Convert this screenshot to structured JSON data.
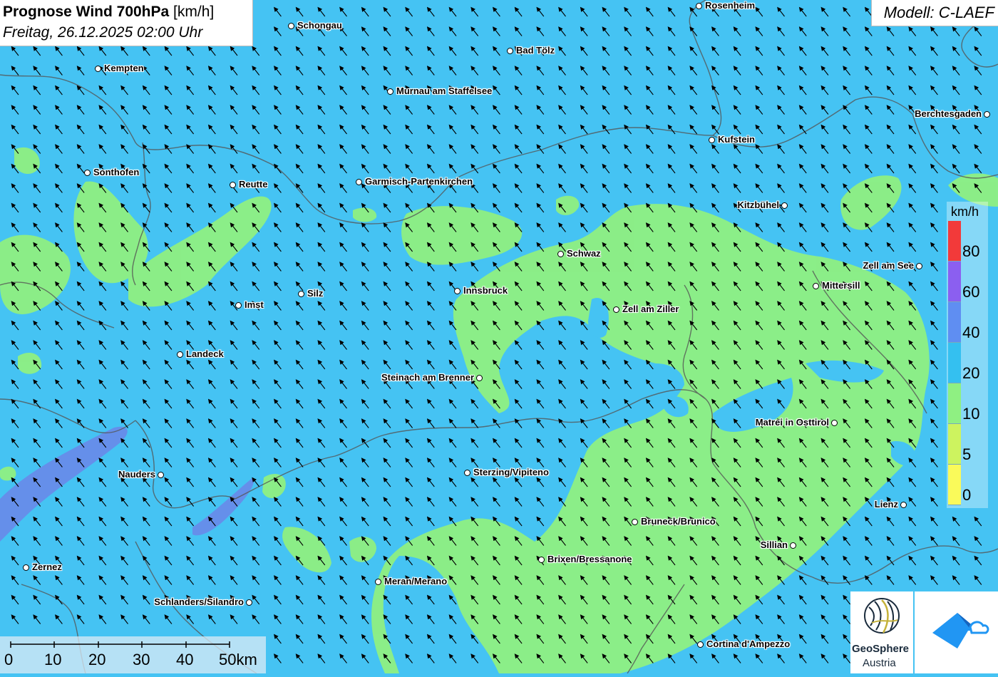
{
  "header": {
    "title_bold": "Prognose Wind 700hPa",
    "title_unit": "[km/h]",
    "subtitle": "Freitag, 26.12.2025 02:00 Uhr",
    "model": "Modell: C-LAEF"
  },
  "legend": {
    "unit": "km/h",
    "levels": [
      {
        "label": "80",
        "color": "#f23a3a"
      },
      {
        "label": "60",
        "color": "#8b5ff0"
      },
      {
        "label": "40",
        "color": "#5f8ef2"
      },
      {
        "label": "20",
        "color": "#34c0f0"
      },
      {
        "label": "10",
        "color": "#8ff082"
      },
      {
        "label": "5",
        "color": "#cdf35f"
      },
      {
        "label": "0",
        "color": "#fafa5a"
      }
    ]
  },
  "scalebar": {
    "labels": [
      "0",
      "10",
      "20",
      "30",
      "40",
      "50km"
    ]
  },
  "places": [
    {
      "name": "Rosenheim"
    },
    {
      "name": "Schongau"
    },
    {
      "name": "Bad Tölz"
    },
    {
      "name": "Kempten"
    },
    {
      "name": "Murnau am Staffelsee"
    },
    {
      "name": "Berchtesgaden"
    },
    {
      "name": "Kufstein"
    },
    {
      "name": "Sonthofen"
    },
    {
      "name": "Reutte"
    },
    {
      "name": "Garmisch-Partenkirchen"
    },
    {
      "name": "Kitzbühel"
    },
    {
      "name": "Schwaz"
    },
    {
      "name": "Zell am See"
    },
    {
      "name": "Mittersill"
    },
    {
      "name": "Innsbruck"
    },
    {
      "name": "Silz"
    },
    {
      "name": "Imst"
    },
    {
      "name": "Zell am Ziller"
    },
    {
      "name": "Landeck"
    },
    {
      "name": "Steinach am Brenner"
    },
    {
      "name": "Matrei in Osttirol"
    },
    {
      "name": "Nauders"
    },
    {
      "name": "Sterzing/Vipiteno"
    },
    {
      "name": "Lienz"
    },
    {
      "name": "Bruneck/Brunico"
    },
    {
      "name": "Sillian"
    },
    {
      "name": "Brixen/Bressanone"
    },
    {
      "name": "Zernez"
    },
    {
      "name": "Meran/Merano"
    },
    {
      "name": "Schlanders/Silandro"
    },
    {
      "name": "Cortina d'Ampezzo"
    }
  ],
  "logos": {
    "geosphere_name": "GeoSphere",
    "geosphere_sub": "Austria"
  },
  "map_layers": {
    "base_color": "#45c3f3",
    "low_wind_color": "#8ff082",
    "strong_wind_color": "#6b86e8",
    "arrow_direction": "north-west"
  }
}
